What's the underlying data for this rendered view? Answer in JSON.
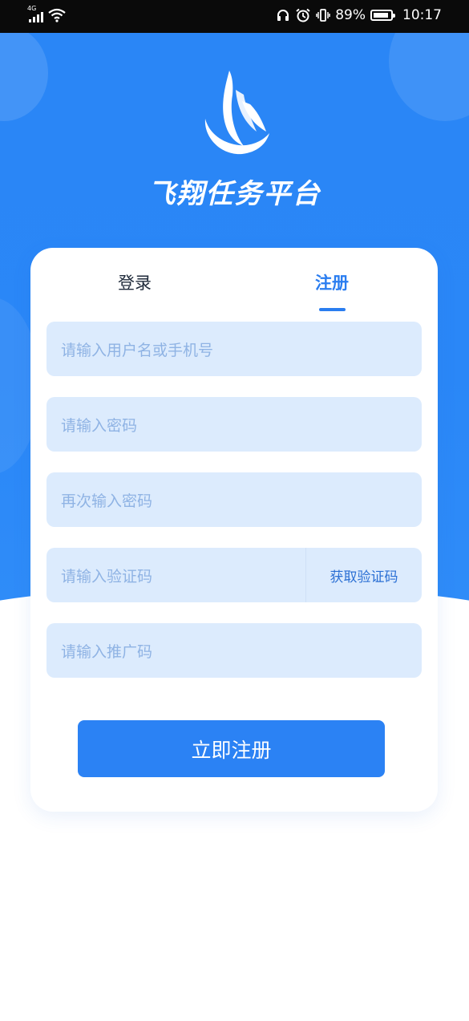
{
  "status_bar": {
    "network": "4G",
    "battery_percent": "89%",
    "battery_level": 0.89,
    "time": "10:17"
  },
  "app": {
    "title": "飞翔任务平台"
  },
  "tabs": [
    {
      "label": "登录",
      "active": false
    },
    {
      "label": "注册",
      "active": true
    }
  ],
  "form": {
    "username_placeholder": "请输入用户名或手机号",
    "password_placeholder": "请输入密码",
    "confirm_placeholder": "再次输入密码",
    "code_placeholder": "请输入验证码",
    "get_code_label": "获取验证码",
    "promo_placeholder": "请输入推广码",
    "submit_label": "立即注册"
  },
  "colors": {
    "primary": "#2b82f4",
    "field_bg": "#dcebfd",
    "placeholder": "#8fb3e4"
  }
}
